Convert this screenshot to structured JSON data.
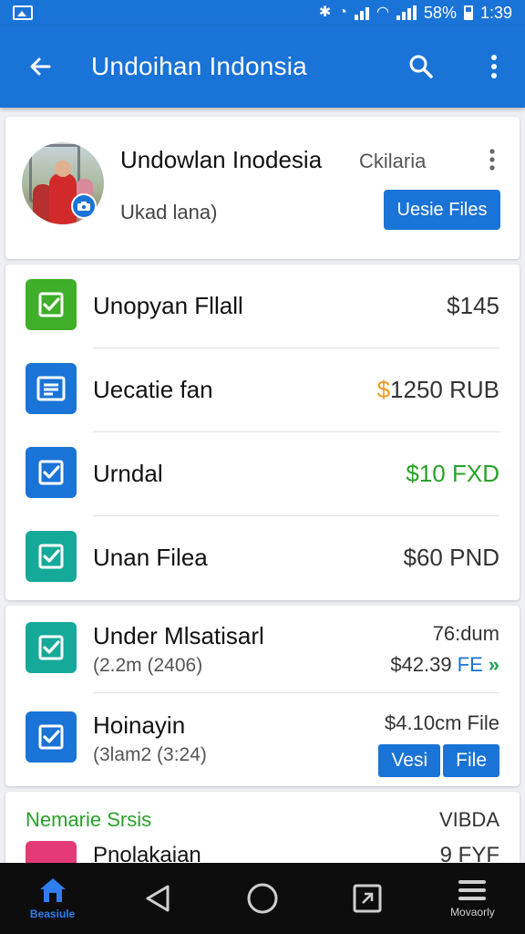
{
  "status_bar": {
    "battery": "58%",
    "time": "1:39",
    "icons": [
      "image-icon",
      "bluetooth-icon",
      "signal-icon",
      "wifi-icon",
      "battery-icon"
    ]
  },
  "app_bar": {
    "title": "Undoihan Indonsia",
    "back_icon": "arrow-back-icon",
    "search_icon": "search-icon",
    "more_icon": "more-vert-icon"
  },
  "profile": {
    "name": "Undowlan Inodesia",
    "tag": "Ckilaria",
    "subtitle": "Ukad lana)",
    "button_label": "Uesie Files"
  },
  "list1": [
    {
      "label": "Unopyan Fllall",
      "amount": "$145",
      "icon": "check-square-icon",
      "icon_color": "#3fae29",
      "amount_color": "#333333"
    },
    {
      "label": "Uecatie fan",
      "amount_prefix": "$",
      "amount_prefix_color": "#f29a1a",
      "amount": "1250 RUB",
      "icon": "document-icon",
      "icon_color": "#1a73d6",
      "amount_color": "#333333"
    },
    {
      "label": "Urndal",
      "amount": "$10 FXD",
      "icon": "check-square-icon",
      "icon_color": "#1a73d6",
      "amount_color": "#2aa12a"
    },
    {
      "label": "Unan Filea",
      "amount": "$60 PND",
      "icon": "check-square-icon",
      "icon_color": "#15a99a",
      "amount_color": "#333333"
    }
  ],
  "list2": [
    {
      "title": "Under Mlsatisarl",
      "sub": "(2.2m (2406)",
      "meta": "76:dum",
      "amount": "$42.39",
      "file_label": "FE",
      "chevron": "»",
      "icon": "check-square-icon",
      "icon_color": "#15a99a"
    },
    {
      "title": "Hoinayin",
      "sub": "(3lam2 (3:24)",
      "meta": "$4.10cm File",
      "btn1": "Vesi",
      "btn2": "File",
      "icon": "check-square-icon",
      "icon_color": "#1a73d6"
    }
  ],
  "section": {
    "title": "Nemarie Srsis",
    "right": "VIBDA",
    "row_label": "Pnolakaian",
    "row_amount": "9 FYF",
    "title_color": "#2aa12a"
  },
  "bottom_nav": [
    {
      "label": "Beasiule",
      "icon": "home-icon",
      "active": true
    },
    {
      "label": "",
      "icon": "back-triangle-icon",
      "active": false
    },
    {
      "label": "",
      "icon": "home-circle-icon",
      "active": false
    },
    {
      "label": "",
      "icon": "recents-icon",
      "active": false
    },
    {
      "label": "Movaorly",
      "icon": "menu-icon",
      "active": false
    }
  ]
}
